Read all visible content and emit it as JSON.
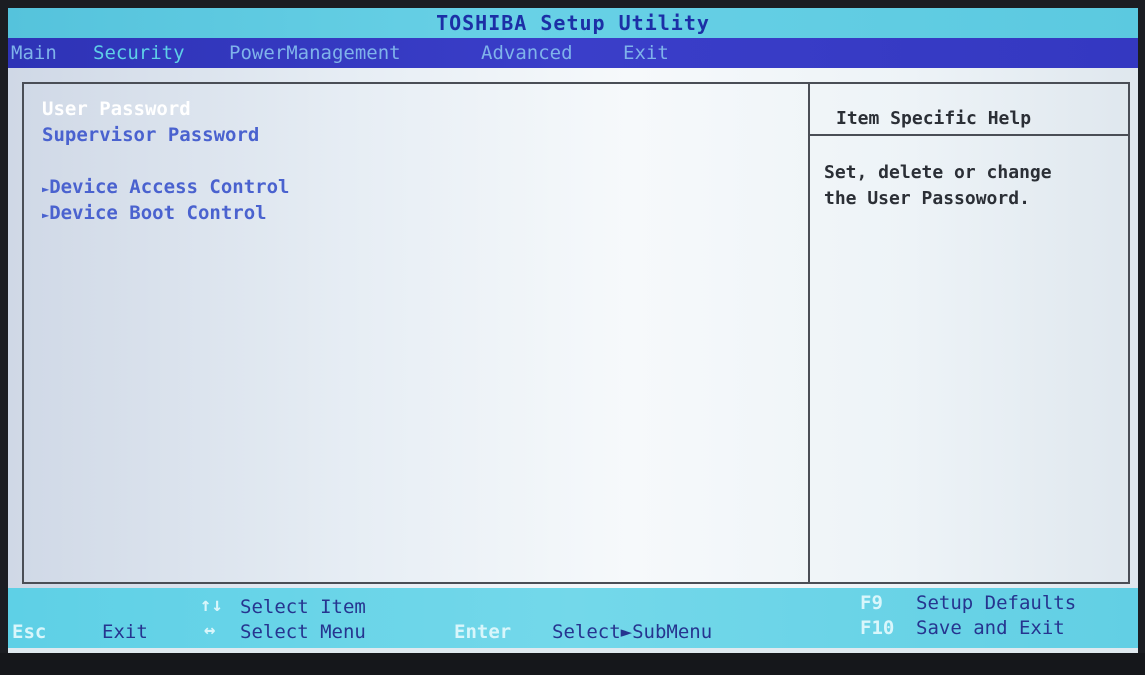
{
  "title": "TOSHIBA Setup Utility",
  "menu": {
    "main": "Main",
    "security": "Security",
    "power": "PowerManagement",
    "advanced": "Advanced",
    "exit": "Exit"
  },
  "options": {
    "user_password": "User Password",
    "supervisor_password": "Supervisor Password",
    "device_access": "Device Access Control",
    "device_boot": "Device Boot Control",
    "submenu_marker": "►"
  },
  "help": {
    "title": "Item Specific Help",
    "text": "Set, delete or change\nthe User Passoword."
  },
  "footer": {
    "up_down_keys": "↑↓",
    "select_item": "Select Item",
    "esc_key": "Esc",
    "exit": "Exit",
    "left_right_keys": "↔",
    "select_menu": "Select Menu",
    "enter_key": "Enter",
    "select_submenu": "Select►SubMenu",
    "f9_key": "F9",
    "setup_defaults": "Setup Defaults",
    "f10_key": "F10",
    "save_exit": "Save and Exit"
  },
  "colors": {
    "title_bg": "#5ec8df",
    "menu_bg": "#3438c1",
    "option_text": "#4a62cf",
    "selected_text": "#ffffff",
    "footer_bg": "#66d3e7"
  }
}
